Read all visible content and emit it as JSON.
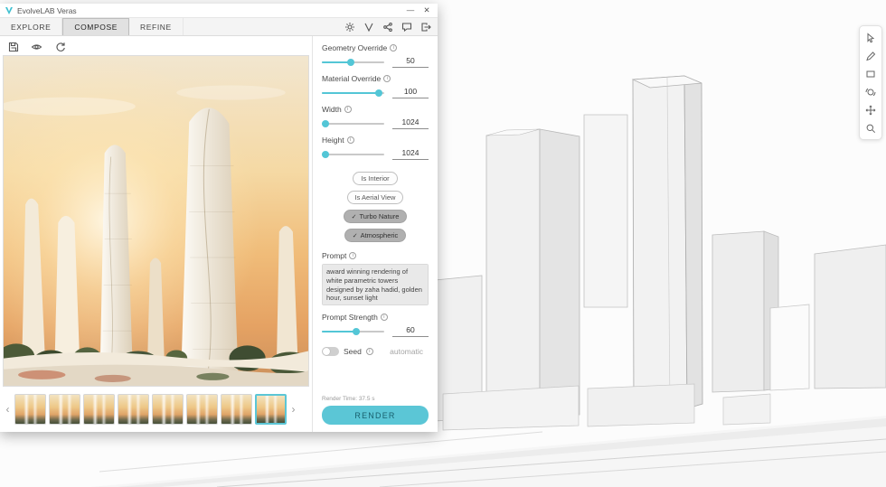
{
  "accent_color": "#5bc6d6",
  "window": {
    "title": "EvolveLAB Veras",
    "tabs": [
      {
        "label": "EXPLORE",
        "active": false
      },
      {
        "label": "COMPOSE",
        "active": true
      },
      {
        "label": "REFINE",
        "active": false
      }
    ]
  },
  "icons": {
    "info": "i",
    "check": "✓",
    "minimize": "—",
    "close": "✕",
    "prev": "‹",
    "next": "›"
  },
  "panel": {
    "geometry": {
      "label": "Geometry Override",
      "value": "50"
    },
    "material": {
      "label": "Material Override",
      "value": "100"
    },
    "width": {
      "label": "Width",
      "value": "1024"
    },
    "height": {
      "label": "Height",
      "value": "1024"
    },
    "chips": [
      {
        "label": "Is Interior",
        "selected": false
      },
      {
        "label": "Is Aerial View",
        "selected": false
      },
      {
        "label": "Turbo Nature",
        "selected": true
      },
      {
        "label": "Atmospheric",
        "selected": true
      }
    ],
    "prompt": {
      "label": "Prompt",
      "value": "award winning rendering of white parametric towers designed by zaha hadid, golden hour, sunset light"
    },
    "prompt_strength": {
      "label": "Prompt Strength",
      "value": "60"
    },
    "seed": {
      "label": "Seed",
      "value": "automatic"
    },
    "render_time": "Render Time: 37.5 s",
    "render_button": "RENDER"
  },
  "thumbnails": {
    "count": 8,
    "selected_index": 7
  }
}
